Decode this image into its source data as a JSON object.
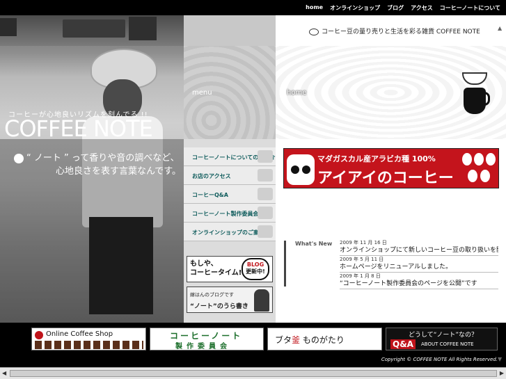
{
  "topnav": {
    "items": [
      "home",
      "オンラインショップ",
      "ブログ",
      "アクセス",
      "コーヒーノートについて"
    ]
  },
  "header": {
    "subtitle": "コーヒー豆の量り売りと生活を彩る雑貨 COFFEE NOTE",
    "menu_label": "menu",
    "home_label": "home"
  },
  "brand": {
    "tag": "コーヒーが心地良いリズムを刻んでる !!",
    "title": "COFFEE NOTE",
    "tagline_1": "“ ノート ” って香りや音の調べなど、",
    "tagline_2": "心地良さを表す言葉なんです。"
  },
  "menu": {
    "items": [
      "コーヒーノートについてのご紹介",
      "お店のアクセス",
      "コーヒーQ&A",
      "コーヒーノート製作委員会",
      "オンラインショップのご案内"
    ]
  },
  "banners": {
    "blog_text": "もしや、\nコーヒータイム!?",
    "blog_badge_1": "BLOG",
    "blog_badge_2": "更新中!",
    "note_text_1": "嫁はんのブログです",
    "note_text_2": "“ノート”のうら書き"
  },
  "ad": {
    "line1": "マダガスカル産アラビカ種 100%",
    "line2": "アイアイのコーヒー"
  },
  "news": {
    "label": "What's New",
    "items": [
      {
        "date": "2009 年 11 月 16 日",
        "text": "オンラインショップにて新しいコーヒー豆の取り扱いを開始しました。"
      },
      {
        "date": "2009 年 5 月 11 日",
        "text": "ホームページをリニューアルしました。"
      },
      {
        "date": "2009 年 1 月 8 日",
        "text": "“コーヒーノート製作委員会のページを公開”です"
      }
    ]
  },
  "bottom": {
    "shop": "Online Coffee Shop",
    "committee_1": "コーヒーノート",
    "committee_2": "製作委員会",
    "buta_1": "ブタ",
    "buta_2": "釜",
    "buta_3": "ものがたり",
    "about_1": "どうして“ノート”なの？",
    "about_qa": "Q&A",
    "about_2": "ABOUT COFFEE NOTE"
  },
  "footer": {
    "copyright": "Copyright © COFFEE NOTE All Rights Reserved."
  }
}
